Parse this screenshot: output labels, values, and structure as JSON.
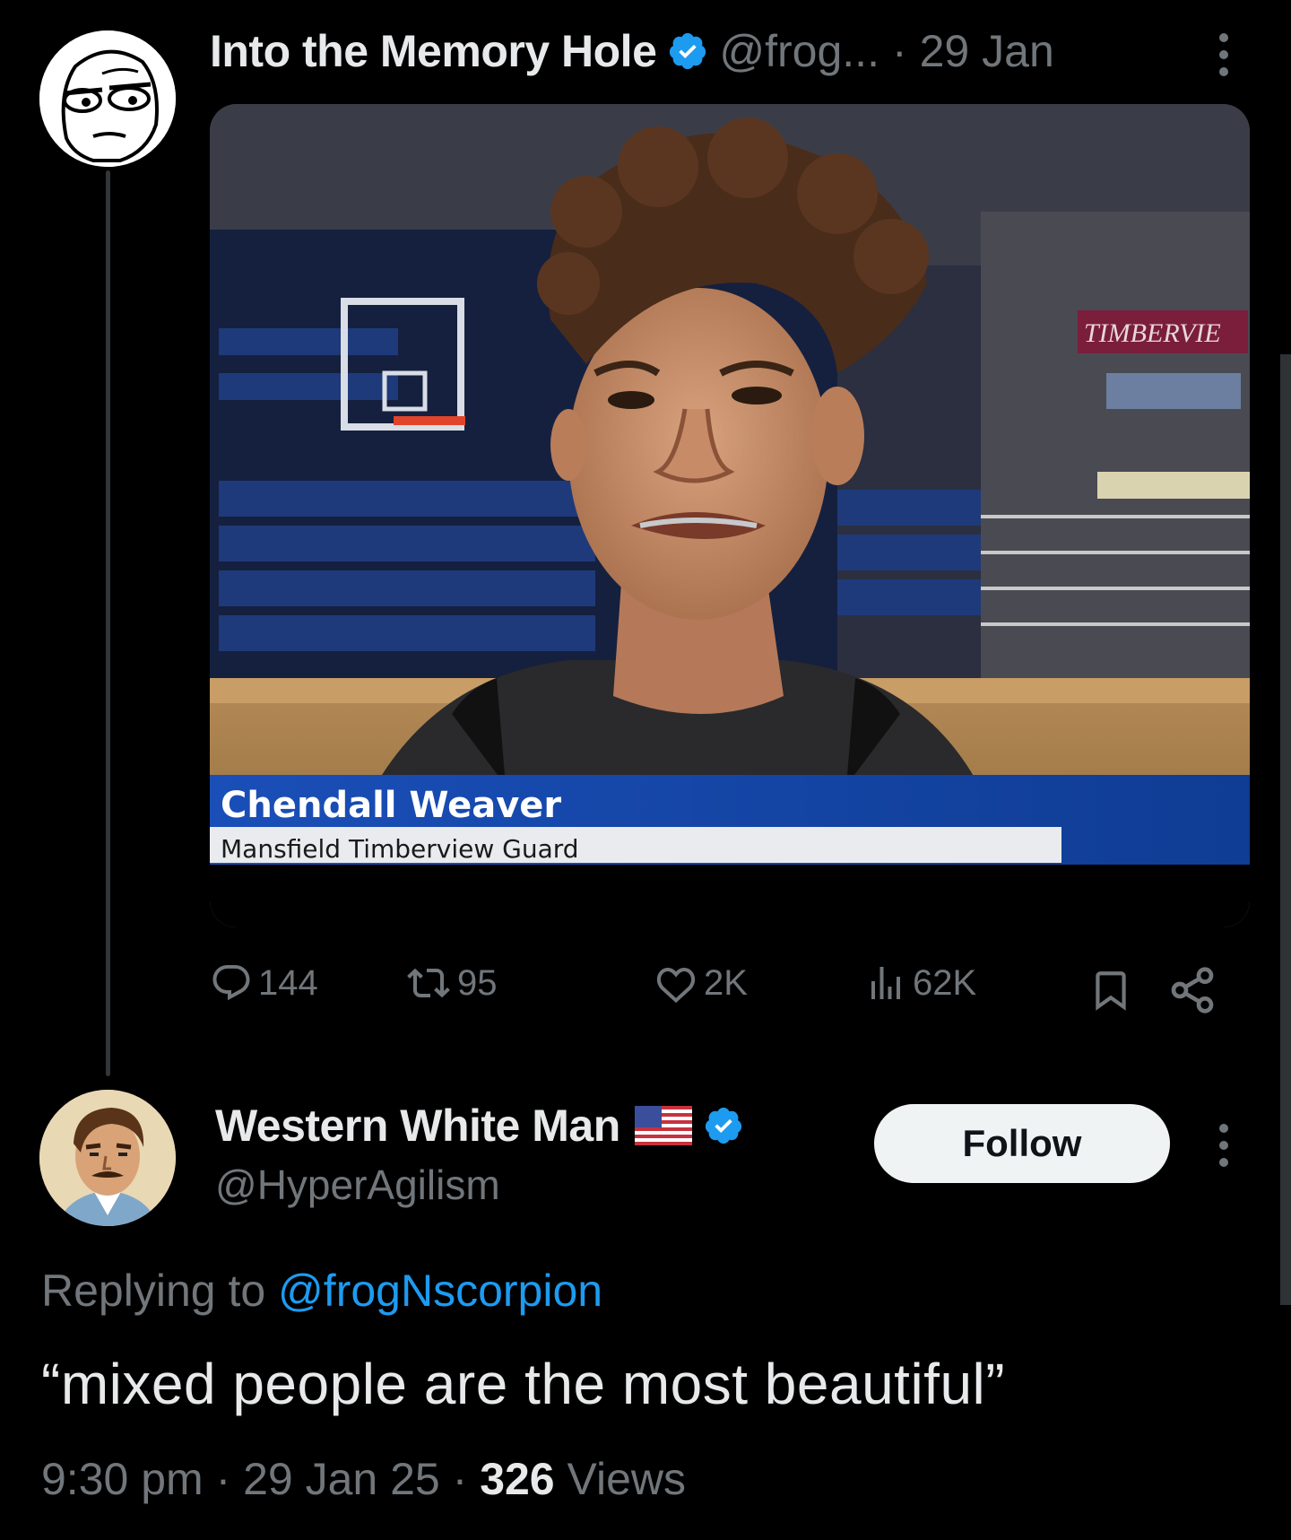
{
  "parent_tweet": {
    "display_name": "Into the Memory Hole",
    "handle": "@frog...",
    "separator": "·",
    "date": "29 Jan",
    "media": {
      "caption_name": "Chendall Weaver",
      "caption_sub": "Mansfield Timberview Guard",
      "banner_text": "TIMBERVIE"
    },
    "stats": {
      "replies": "144",
      "reposts": "95",
      "likes": "2K",
      "views": "62K"
    },
    "icons": [
      "verified-badge-icon",
      "more-options-icon",
      "reply-icon",
      "repost-icon",
      "like-icon",
      "views-icon",
      "bookmark-icon",
      "share-icon"
    ]
  },
  "reply_tweet": {
    "display_name": "Western White Man",
    "handle": "@HyperAgilism",
    "follow_label": "Follow",
    "replying_prefix": "Replying to ",
    "replying_to": "@frogNscorpion",
    "text": "“mixed people are the most beautiful”",
    "time": "9:30 pm",
    "sep": " · ",
    "date": "29 Jan 25",
    "views_count": "326",
    "views_label": " Views"
  },
  "colors": {
    "background": "#000000",
    "text": "#e7e9ea",
    "muted": "#71767b",
    "accent": "#1d9bf0",
    "follow_bg": "#eff3f4"
  }
}
